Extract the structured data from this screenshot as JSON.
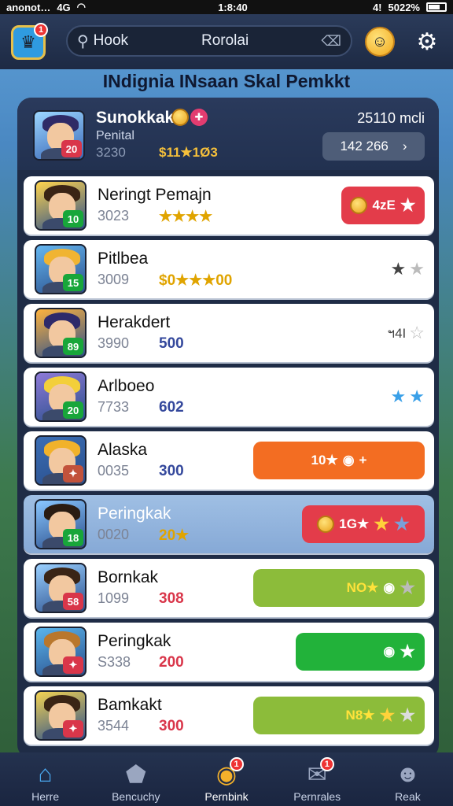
{
  "status": {
    "carrier": "anonot…",
    "network": "4G",
    "time": "1:8:40",
    "battery": "5022%",
    "signal": "4!"
  },
  "topbar": {
    "home_badge": "1",
    "search_label": "Hook",
    "search_center": "Rorolai",
    "search_clear_icon": "tag-icon"
  },
  "title": "INdignia INsaan Skal Pemkkt",
  "me": {
    "name": "Sunokkak",
    "subtitle": "Penital",
    "score": "3230",
    "gold": "$11★1Ø3",
    "points": "25110 mcli",
    "pill": "142 266",
    "level": "20"
  },
  "rows": [
    {
      "name": "Neringt Pemajn",
      "score": "3023",
      "value": "★★★★",
      "value_color": "#e0a400",
      "level": "10",
      "level_color": "#18a63a",
      "action": "4zE",
      "action_type": "red-coin",
      "hair": "#3a2415",
      "bg": "#ffd44d"
    },
    {
      "name": "Pitlbea",
      "score": "3009",
      "value": "$0★★★00",
      "value_color": "#e0a400",
      "level": "15",
      "level_color": "#18a63a",
      "action": "",
      "action_type": "stars-dark",
      "hair": "#f0b432",
      "bg": "#64b6f0"
    },
    {
      "name": "Herakdert",
      "score": "3990",
      "value": "500",
      "value_color": "#34489c",
      "level": "89",
      "level_color": "#18a63a",
      "action": "ฯ4I",
      "action_type": "stars-outline",
      "hair": "#2e2a6a",
      "bg": "#ffb33d"
    },
    {
      "name": "Arlboeo",
      "score": "7733",
      "value": "602",
      "value_color": "#34489c",
      "level": "20",
      "level_color": "#18a63a",
      "action": "",
      "action_type": "stars-blue",
      "hair": "#f3cf3a",
      "bg": "#8e7ad8"
    },
    {
      "name": "Alaska",
      "score": "0035",
      "value": "300",
      "value_color": "#34489c",
      "level": "",
      "level_color": "#c2523b",
      "action": "10★",
      "action_type": "orange",
      "hair": "#f1b22b",
      "bg": "#3a6db4"
    },
    {
      "name": "Peringkak",
      "score": "0020",
      "value": "20★",
      "value_color": "#e0a400",
      "level": "18",
      "level_color": "#18a63a",
      "action": "1G★",
      "action_type": "red-stars",
      "hair": "#2a1c12",
      "bg": "#8ac7ff"
    },
    {
      "name": "Bornkak",
      "score": "1099",
      "value": "308",
      "value_color": "#d9364a",
      "level": "58",
      "level_color": "#d9364a",
      "action": "NO★",
      "action_type": "lime",
      "hair": "#3a2415",
      "bg": "#9ad0ff"
    },
    {
      "name": "Peringkak",
      "score": "S338",
      "value": "200",
      "value_color": "#d9364a",
      "level": "",
      "level_color": "#d9364a",
      "action": "",
      "action_type": "green",
      "hair": "#b9772c",
      "bg": "#5ab5ec"
    },
    {
      "name": "Bamkakt",
      "score": "3544",
      "value": "300",
      "value_color": "#d9364a",
      "level": "",
      "level_color": "#d9364a",
      "action": "N8★",
      "action_type": "lime-stars",
      "hair": "#3a2415",
      "bg": "#f4d352"
    }
  ],
  "tabs": [
    {
      "label": "Herre",
      "icon": "home-icon",
      "badge": ""
    },
    {
      "label": "Bencuchy",
      "icon": "pentagon-icon",
      "badge": ""
    },
    {
      "label": "Pernbink",
      "icon": "coin-icon",
      "badge": "1"
    },
    {
      "label": "Pernrales",
      "icon": "mail-icon",
      "badge": "1"
    },
    {
      "label": "Reak",
      "icon": "person-icon",
      "badge": ""
    }
  ],
  "colors": {
    "accent": "#2f9be0",
    "gold": "#f6c03b",
    "red": "#e33c4a",
    "orange": "#f36d22",
    "green": "#22b23a",
    "lime": "#8cbc3a"
  }
}
